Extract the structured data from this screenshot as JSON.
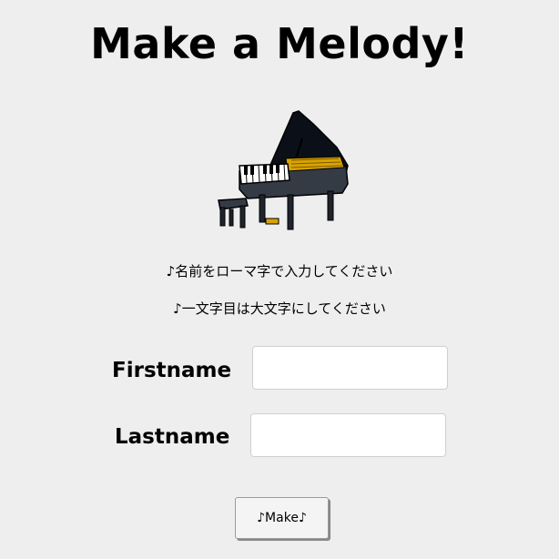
{
  "page": {
    "title": "Make a Melody!"
  },
  "instructions": {
    "line1": "♪名前をローマ字で入力してください",
    "line2": "♪一文字目は大文字にしてください"
  },
  "form": {
    "firstname_label": "Firstname",
    "firstname_value": "",
    "lastname_label": "Lastname",
    "lastname_value": "",
    "make_button_label": "♪Make♪"
  },
  "illustration": {
    "icon": "grand-piano-icon"
  },
  "colors": {
    "background": "#eeeeee",
    "piano_body": "#1f232b",
    "piano_strings": "#d9a300"
  }
}
